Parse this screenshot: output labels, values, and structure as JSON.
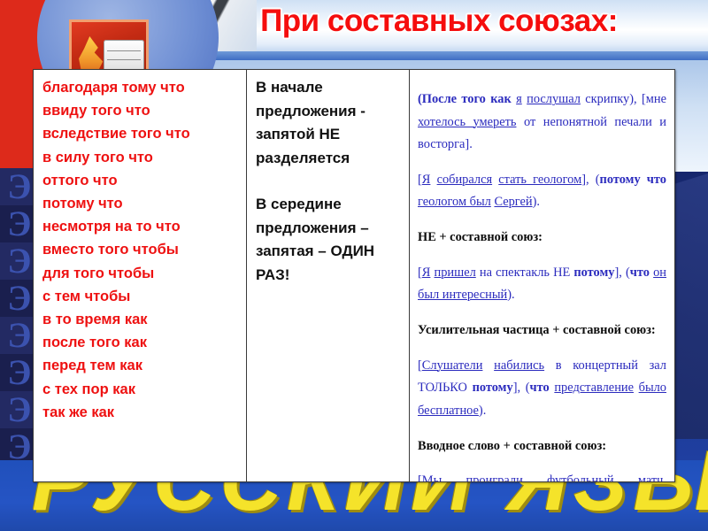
{
  "title": "При составных союзах:",
  "background": {
    "side_letter": "Э",
    "bottom_word": "РУССКИЙ ЯЗЫК",
    "emblem_name": "torch-and-book-emblem",
    "colors": {
      "title_red": "#f50d0d",
      "conjunction_red": "#ee1111",
      "example_blue": "#2b2bbe",
      "rule_black": "#111111",
      "slide_blue": "#1f3fa0",
      "banner_red": "#dd2a1b",
      "bottom_yellow": "#f5e32a"
    }
  },
  "table": {
    "column1": {
      "name": "compound-conjunctions-list",
      "items": [
        "благодаря тому что",
        "ввиду того что",
        "вследствие того что",
        "в силу того что",
        "оттого что",
        "потому что",
        "несмотря на то что",
        "вместо того чтобы",
        "для того чтобы",
        "с тем чтобы",
        "в то время как",
        "после того как",
        "перед тем как",
        "с тех пор как",
        "так же как"
      ]
    },
    "column2": {
      "name": "comma-placement-rules",
      "rules": [
        "В начале предложения - запятой НЕ разделяется",
        "В середине предложения – запятая – ОДИН РАЗ!"
      ]
    },
    "column3": {
      "name": "examples",
      "blocks": [
        {
          "kind": "example",
          "text": "(После того как я послушал скрипку), [мне хотелось умереть от непонятной печали и восторга]."
        },
        {
          "kind": "example",
          "text": "[Я собирался стать геологом], (потому что геологом был Сергей)."
        },
        {
          "kind": "heading",
          "text": "НЕ + составной союз:"
        },
        {
          "kind": "example",
          "text": "[Я пришел на спектакль НЕ потому], (что он был интересный)."
        },
        {
          "kind": "heading",
          "text": "Усилительная частица + составной союз:"
        },
        {
          "kind": "example",
          "text": "[Слушатели набились в концертный зал ТОЛЬКО потому], (что представление было бесплатное)."
        },
        {
          "kind": "heading",
          "text": "Вводное слово + составной союз:"
        },
        {
          "kind": "example",
          "text": "[Мы проиграли футбольный матч, ВОЗМОЖНО, в силу того], (что были просчеты в тактике игры)."
        }
      ]
    }
  }
}
